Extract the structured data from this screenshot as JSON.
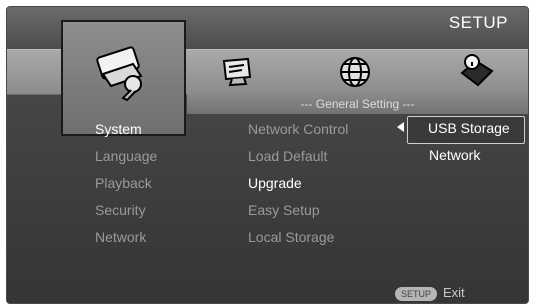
{
  "header": {
    "title": "SETUP"
  },
  "tabs": [
    {
      "name": "system",
      "icon": "tools-icon"
    },
    {
      "name": "display",
      "icon": "monitor-icon"
    },
    {
      "name": "network",
      "icon": "globe-icon"
    },
    {
      "name": "info",
      "icon": "info-book-icon"
    }
  ],
  "sub_header": "--- General Setting ---",
  "left_menu": [
    "System",
    "Language",
    "Playback",
    "Security",
    "Network"
  ],
  "mid_menu": [
    "Network Control",
    "Load Default",
    "Upgrade",
    "Easy Setup",
    "Local Storage"
  ],
  "right_menu": [
    "USB Storage",
    "Network"
  ],
  "footer": {
    "button": "SETUP",
    "label": "Exit"
  },
  "colors": {
    "text_active": "#ffffff",
    "text_inactive": "#9a9a9a",
    "band": "#8c8c8c"
  }
}
